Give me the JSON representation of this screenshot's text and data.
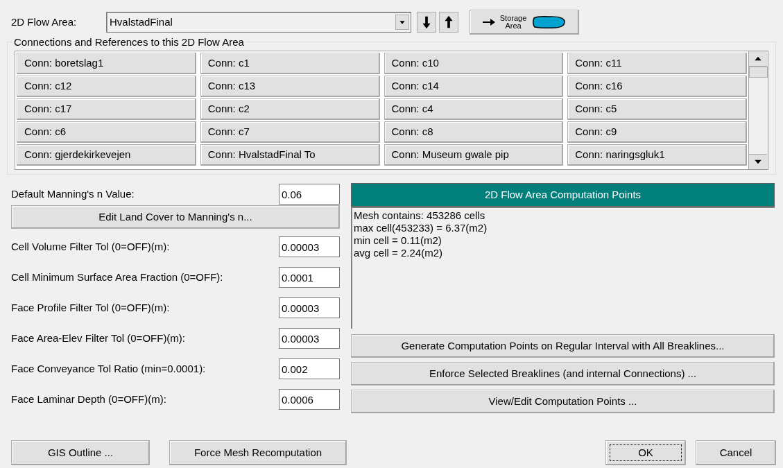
{
  "flow_area": {
    "label": "2D Flow Area:",
    "value": "HvalstadFinal"
  },
  "storage_button": "Storage Area",
  "connections": {
    "title": "Connections and References to this 2D Flow Area",
    "items": [
      "Conn: boretslag1",
      "Conn: c1",
      "Conn: c10",
      "Conn: c11",
      "Conn: c12",
      "Conn: c13",
      "Conn: c14",
      "Conn: c16",
      "Conn: c17",
      "Conn: c2",
      "Conn: c4",
      "Conn: c5",
      "Conn: c6",
      "Conn: c7",
      "Conn: c8",
      "Conn: c9",
      "Conn: gjerdekirkevejen",
      "Conn: HvalstadFinal To",
      "Conn: Museum gwale pip",
      "Conn: naringsgluk1"
    ]
  },
  "parameters": [
    {
      "kind": "field",
      "label": "Default Manning's n Value:",
      "value": "0.06"
    },
    {
      "kind": "button",
      "label": "Edit Land Cover to Manning's n..."
    },
    {
      "kind": "field",
      "label": "Cell Volume Filter Tol (0=OFF)(m):",
      "value": "0.00003"
    },
    {
      "kind": "field",
      "label": "Cell Minimum Surface Area Fraction (0=OFF):",
      "value": "0.0001"
    },
    {
      "kind": "field",
      "label": "Face Profile Filter Tol (0=OFF)(m):",
      "value": "0.00003"
    },
    {
      "kind": "field",
      "label": "Face Area-Elev Filter Tol (0=OFF)(m):",
      "value": "0.00003"
    },
    {
      "kind": "field",
      "label": "Face Conveyance Tol Ratio (min=0.0001):",
      "value": "0.002"
    },
    {
      "kind": "field",
      "label": "Face Laminar Depth (0=OFF)(m):",
      "value": "0.0006"
    }
  ],
  "computation_points": {
    "title": "2D Flow Area Computation Points",
    "lines": [
      "Mesh contains: 453286 cells",
      "max cell(453233) = 6.37(m2)",
      "min cell = 0.11(m2)",
      "avg cell = 2.24(m2)"
    ]
  },
  "action_buttons": [
    "Generate Computation Points on Regular Interval with All Breaklines...",
    "Enforce Selected Breaklines (and internal Connections) ...",
    "View/Edit Computation Points ..."
  ],
  "bottom_buttons": [
    {
      "label": "GIS Outline ...",
      "default": false
    },
    {
      "label": "Force Mesh Recomputation",
      "default": false
    },
    {
      "label": "OK",
      "default": true
    },
    {
      "label": "Cancel",
      "default": false
    }
  ]
}
